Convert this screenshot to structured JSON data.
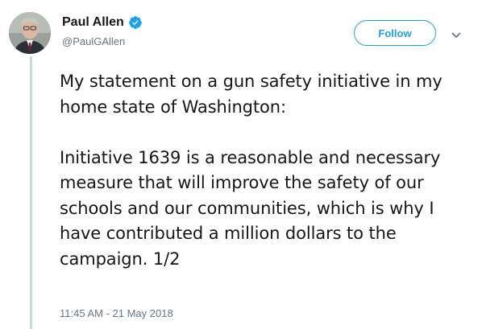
{
  "author": {
    "name": "Paul Allen",
    "handle": "@PaulGAllen",
    "verified": true
  },
  "follow_button": {
    "label": "Follow"
  },
  "tweet": {
    "paragraphs": [
      "My statement on a gun safety initiative in my home state of Washington:",
      "Initiative 1639 is a reasonable and necessary measure that will improve the safety of our schools and our communities, which is why I have contributed a million dollars to the campaign. 1/2"
    ],
    "timestamp": "11:45 AM - 21 May 2018"
  },
  "icons": {
    "verified": "verified-badge-icon",
    "menu": "chevron-down-icon"
  },
  "colors": {
    "accent": "#1da1f2",
    "text": "#14171a",
    "secondary_text": "#657786",
    "thread_line": "#ccd6dd"
  }
}
